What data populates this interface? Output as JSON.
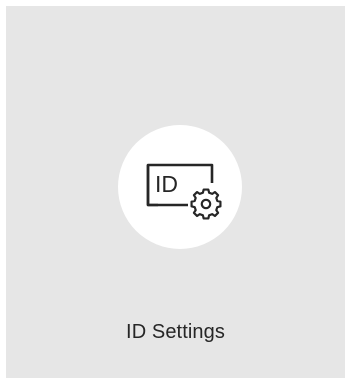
{
  "tile": {
    "label": "ID Settings",
    "icon": "id-settings-icon",
    "icon_text": "ID"
  },
  "colors": {
    "card_background": "#e6e6e6",
    "icon_circle": "#ffffff",
    "icon_stroke": "#262626",
    "label_text": "#262626"
  }
}
